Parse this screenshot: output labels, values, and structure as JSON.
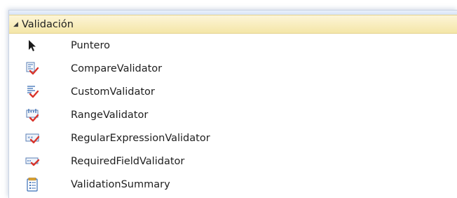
{
  "toolbox": {
    "category": {
      "label": "Validación",
      "expanded_glyph": "◢",
      "icon": "expand-triangle-icon"
    },
    "items": [
      {
        "label": "Puntero",
        "icon": "pointer-arrow-icon"
      },
      {
        "label": "CompareValidator",
        "icon": "compare-validator-icon"
      },
      {
        "label": "CustomValidator",
        "icon": "custom-validator-icon"
      },
      {
        "label": "RangeValidator",
        "icon": "range-validator-icon"
      },
      {
        "label": "RegularExpressionValidator",
        "icon": "regex-validator-icon"
      },
      {
        "label": "RequiredFieldValidator",
        "icon": "required-field-validator-icon"
      },
      {
        "label": "ValidationSummary",
        "icon": "validation-summary-icon"
      }
    ],
    "colors": {
      "check_red": "#d9342b",
      "icon_blue": "#3b6fb6",
      "category_bg": "#f4e6a8"
    }
  }
}
